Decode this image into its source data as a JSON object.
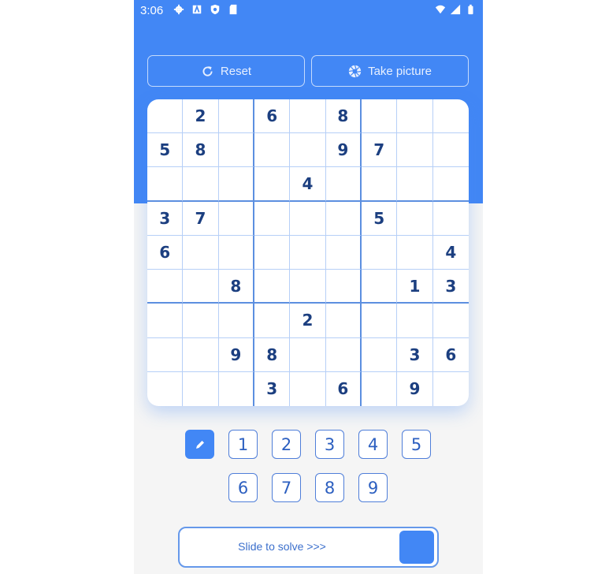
{
  "status_bar": {
    "time": "3:06",
    "left_icons": [
      "gear-icon",
      "a-icon",
      "shield-icon",
      "sd-card-icon"
    ],
    "right_icons": [
      "wifi-icon",
      "signal-icon",
      "battery-icon"
    ]
  },
  "toolbar": {
    "reset_label": "Reset",
    "reset_icon": "refresh-icon",
    "photo_label": "Take picture",
    "photo_icon": "camera-aperture-icon"
  },
  "board": {
    "cells": [
      [
        "",
        "2",
        "",
        "6",
        "",
        "8",
        "",
        "",
        ""
      ],
      [
        "5",
        "8",
        "",
        "",
        "",
        "9",
        "7",
        "",
        ""
      ],
      [
        "",
        "",
        "",
        "",
        "4",
        "",
        "",
        "",
        ""
      ],
      [
        "3",
        "7",
        "",
        "",
        "",
        "",
        "5",
        "",
        ""
      ],
      [
        "6",
        "",
        "",
        "",
        "",
        "",
        "",
        "",
        "4"
      ],
      [
        "",
        "",
        "8",
        "",
        "",
        "",
        "",
        "1",
        "3"
      ],
      [
        "",
        "",
        "",
        "",
        "2",
        "",
        "",
        "",
        ""
      ],
      [
        "",
        "",
        "9",
        "8",
        "",
        "",
        "",
        "3",
        "6"
      ],
      [
        "",
        "",
        "",
        "3",
        "",
        "6",
        "",
        "9",
        ""
      ]
    ]
  },
  "keypad": {
    "pencil_icon": "pencil-icon",
    "numbers": [
      "1",
      "2",
      "3",
      "4",
      "5",
      "6",
      "7",
      "8",
      "9"
    ]
  },
  "slider": {
    "label": "Slide to solve >>>"
  },
  "colors": {
    "primary": "#4287f5",
    "digit": "#1c3f80",
    "background": "#f5f5f5"
  }
}
